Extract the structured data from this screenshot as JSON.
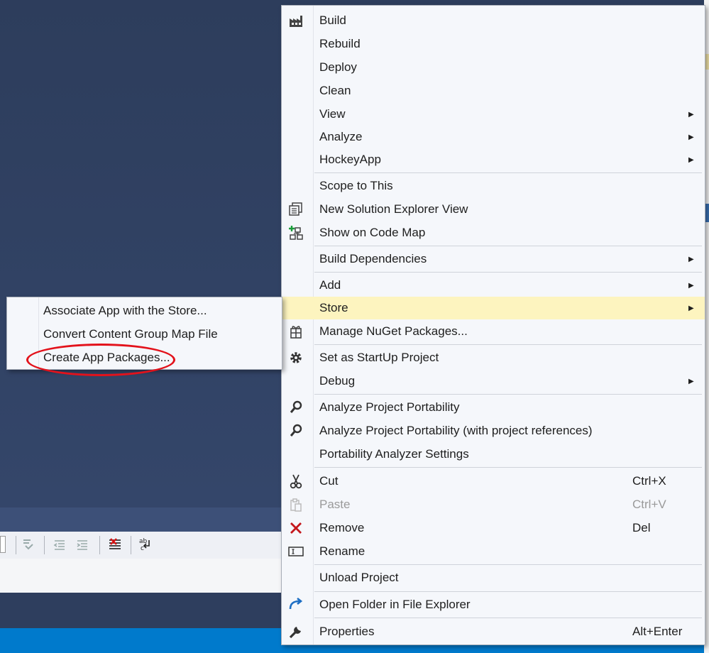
{
  "context_menu": {
    "items": [
      {
        "label": "Build",
        "icon": "build-icon"
      },
      {
        "label": "Rebuild"
      },
      {
        "label": "Deploy"
      },
      {
        "label": "Clean"
      },
      {
        "label": "View",
        "submenu": true
      },
      {
        "label": "Analyze",
        "submenu": true
      },
      {
        "label": "HockeyApp",
        "submenu": true
      },
      {
        "label": "Scope to This"
      },
      {
        "label": "New Solution Explorer View",
        "icon": "new-solution-explorer-view-icon"
      },
      {
        "label": "Show on Code Map",
        "icon": "code-map-icon"
      },
      {
        "label": "Build Dependencies",
        "submenu": true
      },
      {
        "label": "Add",
        "submenu": true
      },
      {
        "label": "Store",
        "submenu": true,
        "highlighted": true
      },
      {
        "label": "Manage NuGet Packages...",
        "icon": "nuget-icon"
      },
      {
        "label": "Set as StartUp Project",
        "icon": "gear-icon"
      },
      {
        "label": "Debug",
        "submenu": true
      },
      {
        "label": "Analyze Project Portability",
        "icon": "magnifier-icon"
      },
      {
        "label": "Analyze Project Portability (with project references)",
        "icon": "magnifier-icon"
      },
      {
        "label": "Portability Analyzer Settings"
      },
      {
        "label": "Cut",
        "shortcut": "Ctrl+X",
        "icon": "scissors-icon"
      },
      {
        "label": "Paste",
        "shortcut": "Ctrl+V",
        "icon": "paste-icon",
        "disabled": true
      },
      {
        "label": "Remove",
        "shortcut": "Del",
        "icon": "remove-x-icon"
      },
      {
        "label": "Rename",
        "icon": "rename-icon"
      },
      {
        "label": "Unload Project"
      },
      {
        "label": "Open Folder in File Explorer",
        "icon": "open-folder-arrow-icon"
      },
      {
        "label": "Properties",
        "shortcut": "Alt+Enter",
        "icon": "wrench-icon"
      }
    ]
  },
  "store_submenu": {
    "items": [
      {
        "label": "Associate App with the Store..."
      },
      {
        "label": "Convert Content Group Map File"
      },
      {
        "label": "Create App Packages...",
        "annotated": true
      }
    ]
  },
  "colors": {
    "highlight": "#fdf4bf",
    "annotation_ring": "#e3121b",
    "status_bar": "#007acc",
    "ide_background": "#2e3e5e"
  }
}
